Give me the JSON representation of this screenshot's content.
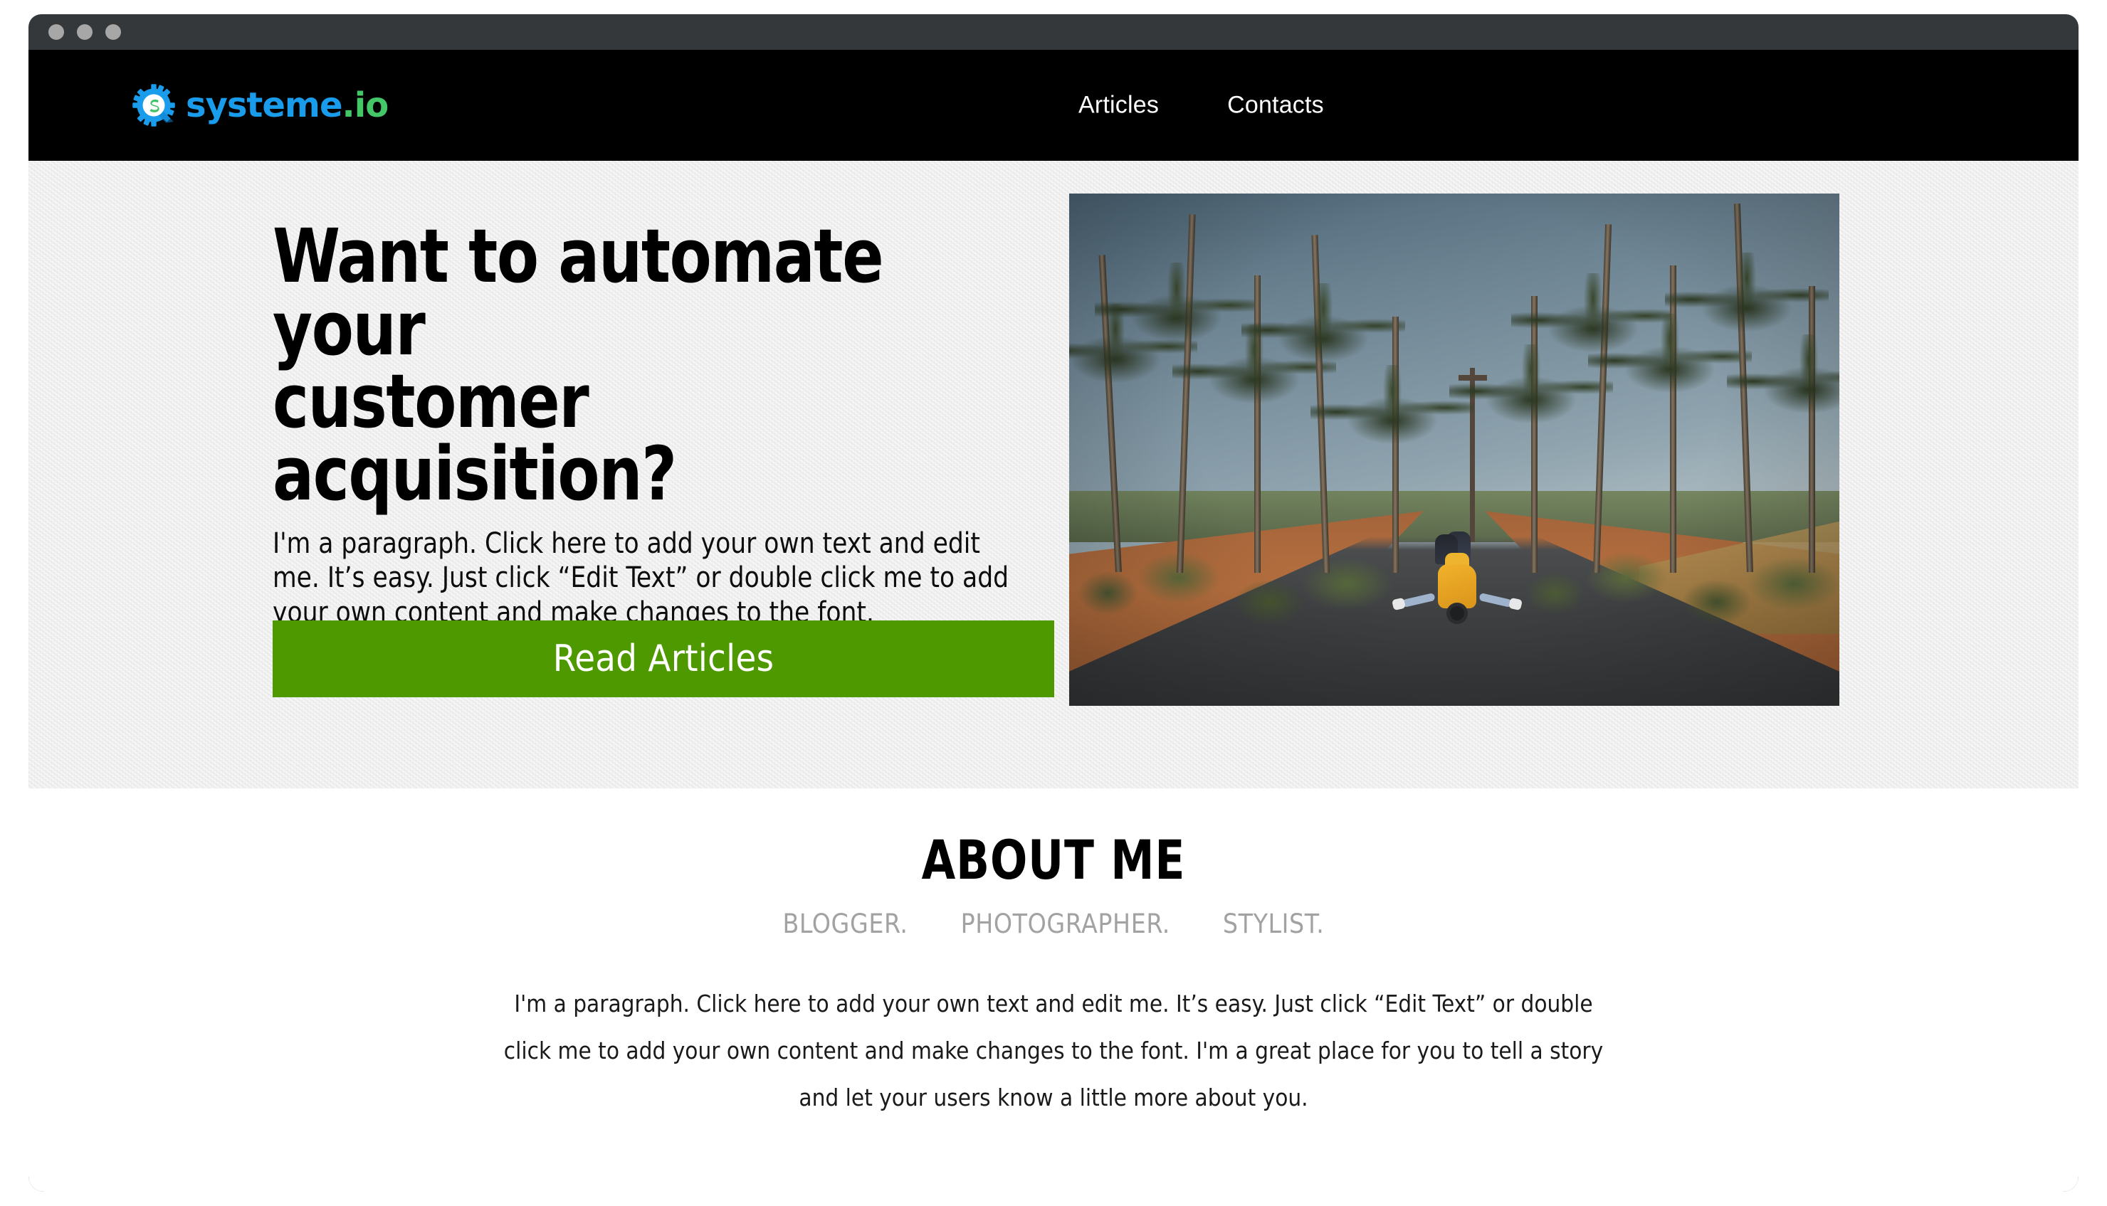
{
  "browser": {
    "traffic_lights": [
      "close-dot",
      "minimize-dot",
      "maximize-dot"
    ]
  },
  "nav": {
    "logo": {
      "icon": "systeme-gear-icon",
      "text_primary": "systeme",
      "text_accent": ".io"
    },
    "links": [
      {
        "label": "Articles"
      },
      {
        "label": "Contacts"
      }
    ]
  },
  "hero": {
    "title": "Want to automate your\ncustomer acquisition?",
    "paragraph": "I'm a paragraph. Click here to add your own text and edit me. It’s easy. Just click “Edit Text” or double click me to add your own content and make changes to the font.",
    "cta_label": "Read Articles",
    "image_alt": "couple-riding-yellow-scooter-on-palm-lined-road"
  },
  "about": {
    "title": "ABOUT ME",
    "roles": [
      "BLOGGER.",
      "PHOTOGRAPHER.",
      "STYLIST."
    ],
    "paragraph": "I'm a paragraph. Click here to add your own text and edit me. It’s easy. Just click “Edit Text” or double click me to add your own content and make changes to the font. I'm a great place for you to tell a story and let your users know a little more about you."
  },
  "colors": {
    "nav_background": "#000000",
    "titlebar": "#35383a",
    "cta_green": "#4f9900",
    "logo_blue": "#1a9cec",
    "logo_green": "#44c767",
    "hero_background": "#f1f1f1",
    "muted_gray": "#a2a2a2"
  }
}
